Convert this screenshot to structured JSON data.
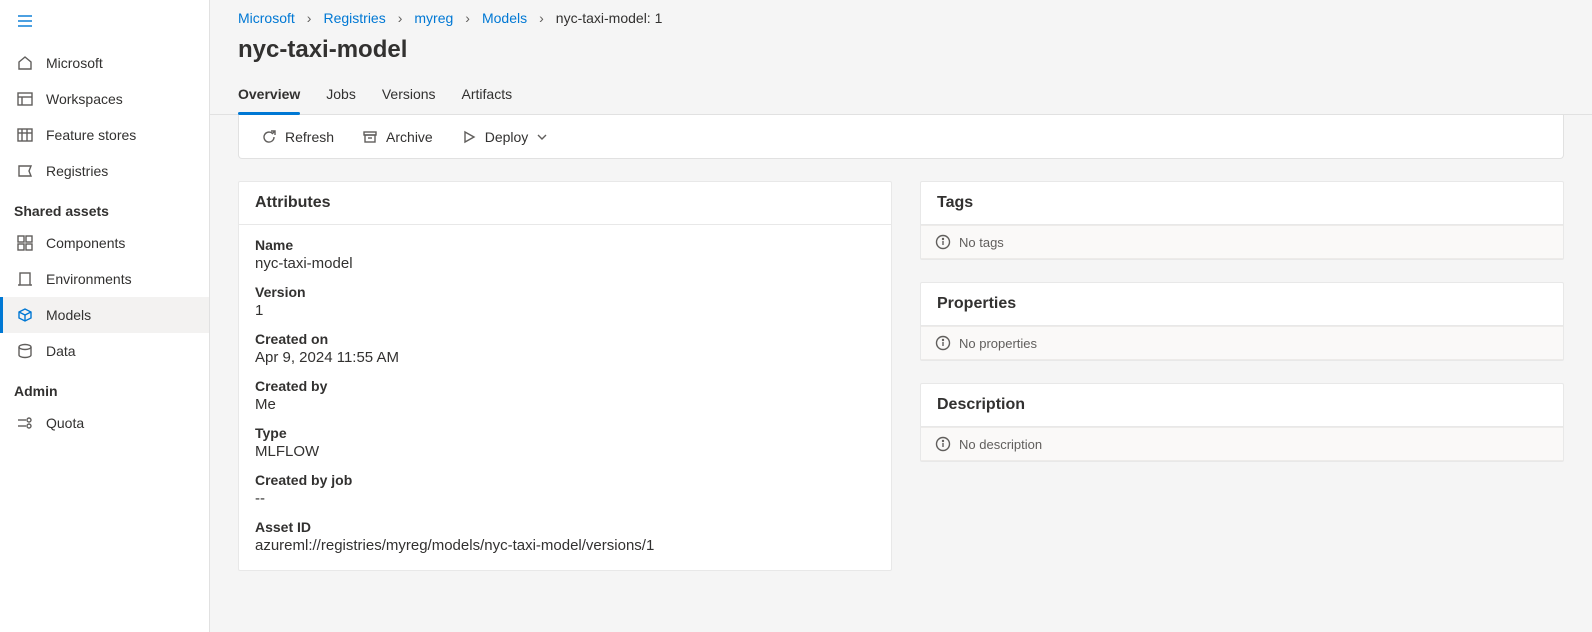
{
  "sidebar": {
    "top": [
      {
        "id": "microsoft",
        "label": "Microsoft"
      },
      {
        "id": "workspaces",
        "label": "Workspaces"
      },
      {
        "id": "feature-stores",
        "label": "Feature stores"
      },
      {
        "id": "registries",
        "label": "Registries"
      }
    ],
    "section_shared": "Shared assets",
    "shared": [
      {
        "id": "components",
        "label": "Components"
      },
      {
        "id": "environments",
        "label": "Environments"
      },
      {
        "id": "models",
        "label": "Models",
        "active": true
      },
      {
        "id": "data",
        "label": "Data"
      }
    ],
    "section_admin": "Admin",
    "admin": [
      {
        "id": "quota",
        "label": "Quota"
      }
    ]
  },
  "breadcrumb": {
    "items": [
      {
        "label": "Microsoft",
        "link": true
      },
      {
        "label": "Registries",
        "link": true
      },
      {
        "label": "myreg",
        "link": true
      },
      {
        "label": "Models",
        "link": true
      },
      {
        "label": "nyc-taxi-model: 1",
        "link": false
      }
    ]
  },
  "page_title": "nyc-taxi-model",
  "tabs": [
    {
      "id": "overview",
      "label": "Overview",
      "active": true
    },
    {
      "id": "jobs",
      "label": "Jobs"
    },
    {
      "id": "versions",
      "label": "Versions"
    },
    {
      "id": "artifacts",
      "label": "Artifacts"
    }
  ],
  "toolbar": {
    "refresh": "Refresh",
    "archive": "Archive",
    "deploy": "Deploy"
  },
  "attributes": {
    "header": "Attributes",
    "name_label": "Name",
    "name_value": "nyc-taxi-model",
    "version_label": "Version",
    "version_value": "1",
    "created_on_label": "Created on",
    "created_on_value": "Apr 9, 2024 11:55 AM",
    "created_by_label": "Created by",
    "created_by_value": "Me",
    "type_label": "Type",
    "type_value": "MLFLOW",
    "created_by_job_label": "Created by job",
    "created_by_job_value": "--",
    "asset_id_label": "Asset ID",
    "asset_id_value": "azureml://registries/myreg/models/nyc-taxi-model/versions/1"
  },
  "tags": {
    "header": "Tags",
    "empty": "No tags"
  },
  "properties": {
    "header": "Properties",
    "empty": "No properties"
  },
  "description": {
    "header": "Description",
    "empty": "No description"
  }
}
